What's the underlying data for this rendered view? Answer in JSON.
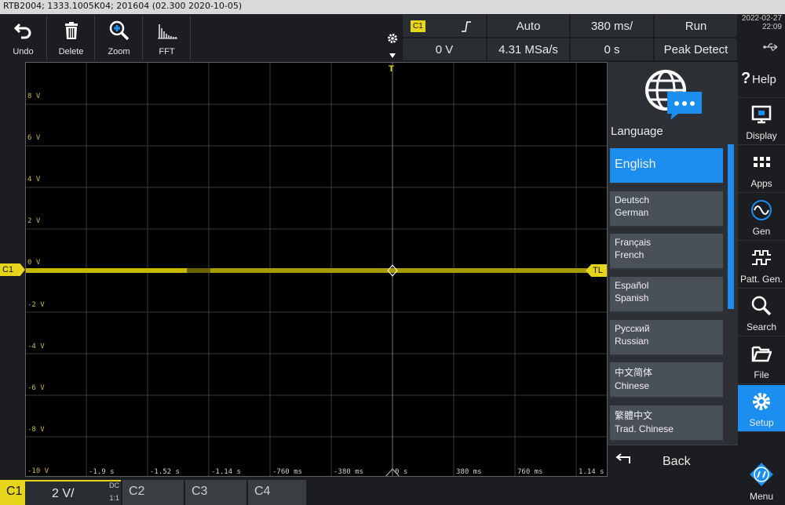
{
  "instrument_info": "RTB2004; 1333.1005K04; 201604 (02.300 2020-10-05)",
  "toolbar": {
    "undo": "Undo",
    "delete": "Delete",
    "zoom": "Zoom",
    "fft": "FFT"
  },
  "header": {
    "channel": "C1",
    "trigger_level": "0 V",
    "trigger_mode": "Auto",
    "sample_rate": "4.31 MSa/s",
    "timebase": "380 ms/",
    "time_offset": "0 s",
    "run_state": "Run",
    "acq_mode": "Peak Detect",
    "date": "2022-02-27",
    "time": "22:09"
  },
  "scope": {
    "y_labels": [
      "8 V",
      "6 V",
      "4 V",
      "2 V",
      "0 V",
      "-2 V",
      "-4 V",
      "-6 V",
      "-8 V",
      "-10 V"
    ],
    "x_labels": [
      "-1.9 s",
      "-1.52 s",
      "-1.14 s",
      "-760 ms",
      "-380 ms",
      "0 s",
      "380 ms",
      "760 ms",
      "1.14 s"
    ],
    "trigger_marker": "T",
    "trigger_level_marker": "TL",
    "channel_marker": "C1",
    "trace_color": "#c8b800"
  },
  "language_panel": {
    "title": "Language",
    "items": [
      {
        "native": "English",
        "english": ""
      },
      {
        "native": "Deutsch",
        "english": "German"
      },
      {
        "native": "Français",
        "english": "French"
      },
      {
        "native": "Español",
        "english": "Spanish"
      },
      {
        "native": "Русский",
        "english": "Russian"
      },
      {
        "native": "中文简体",
        "english": "Chinese"
      },
      {
        "native": "繁體中文",
        "english": "Trad. Chinese"
      }
    ],
    "back": "Back"
  },
  "sidebar": {
    "help": "Help",
    "display": "Display",
    "apps": "Apps",
    "gen": "Gen",
    "patt_gen": "Patt. Gen.",
    "search": "Search",
    "file": "File",
    "setup": "Setup",
    "menu": "Menu"
  },
  "bottom": {
    "c1": "C1",
    "c1_scale": "2 V/",
    "c1_coupling": "DC",
    "c1_probe": "1:1",
    "c2": "C2",
    "c3": "C3",
    "c4": "C4"
  },
  "colors": {
    "accent": "#1b8ef0",
    "channel1": "#e6d51a"
  }
}
